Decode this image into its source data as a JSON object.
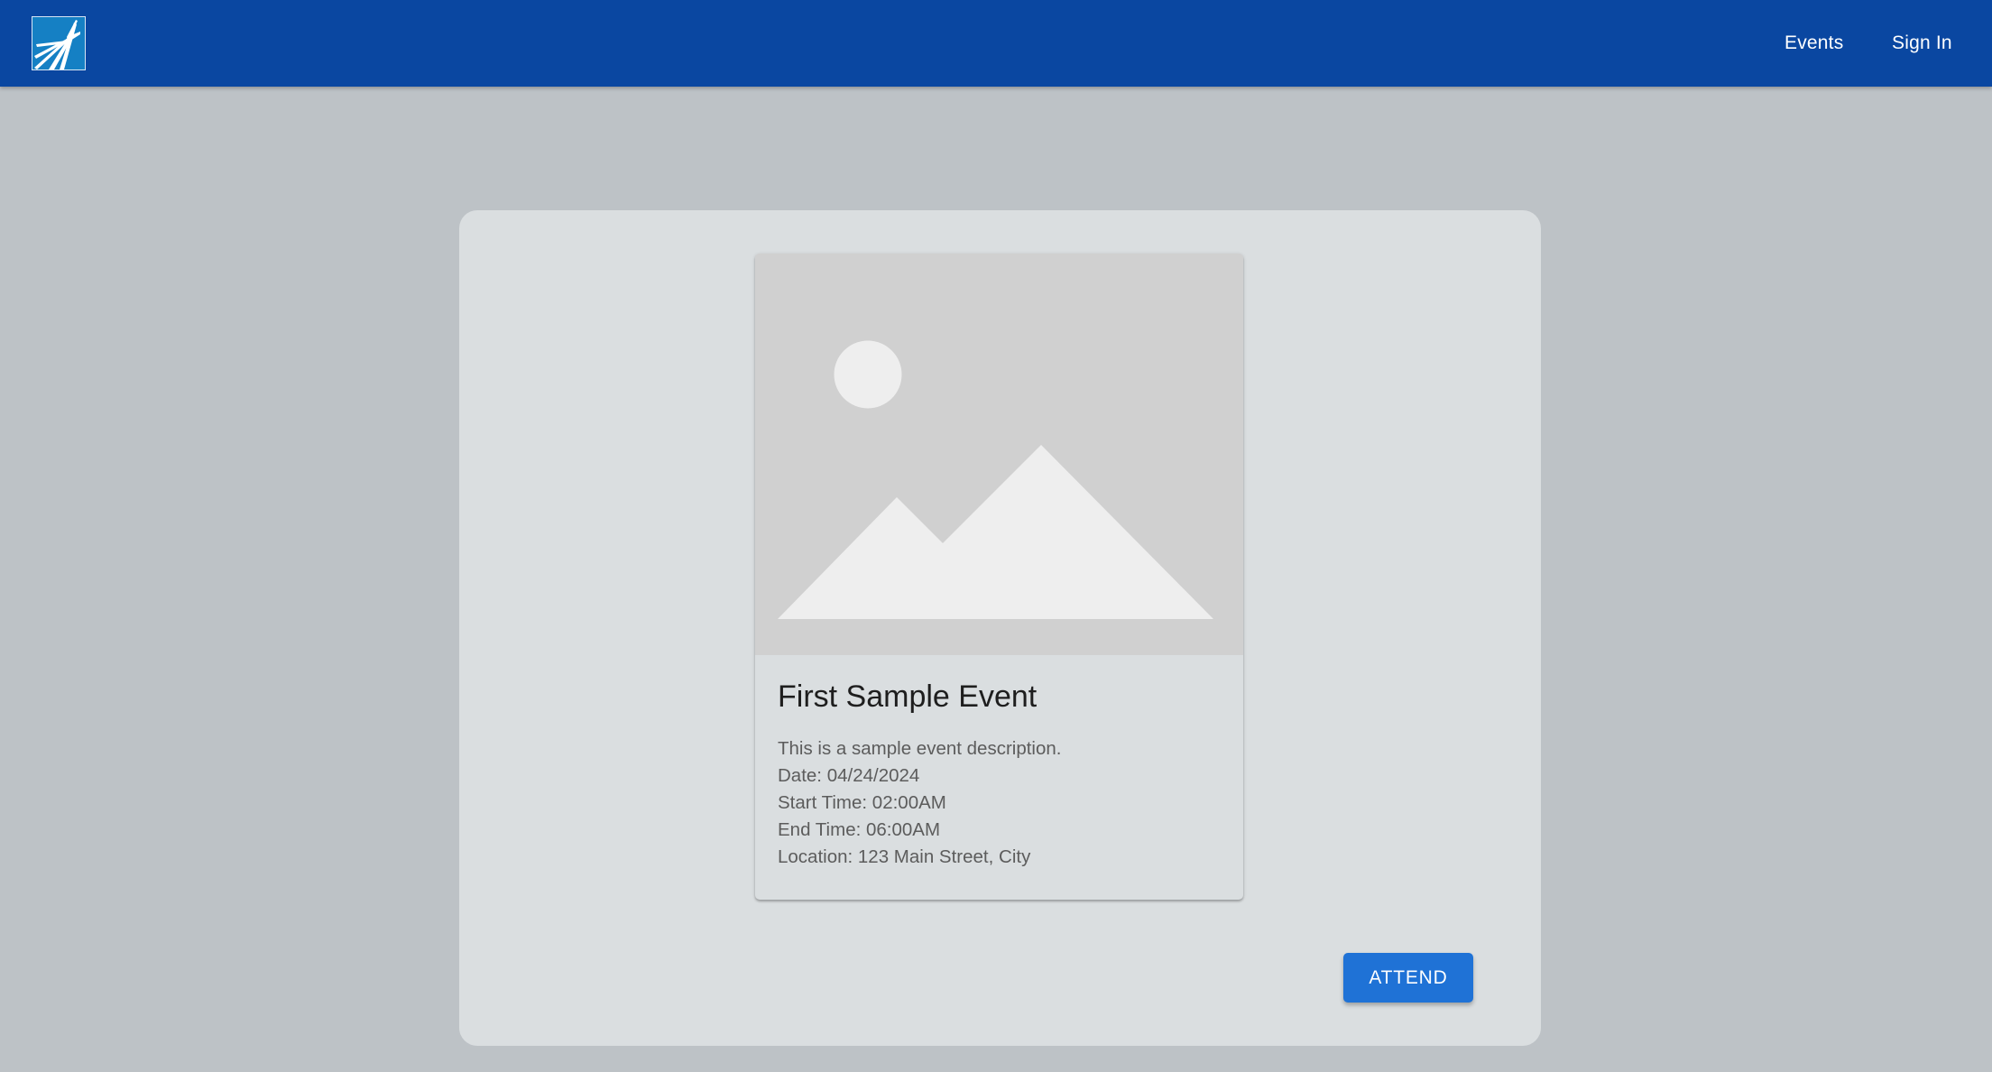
{
  "header": {
    "logo": "jet-plane-logo",
    "nav": {
      "events_label": "Events",
      "signin_label": "Sign In"
    }
  },
  "event_card": {
    "image": "image-placeholder-icon",
    "title": "First Sample Event",
    "description": "This is a sample event description.",
    "date_line": "Date: 04/24/2024",
    "start_line": "Start Time: 02:00AM",
    "end_line": "End Time: 06:00AM",
    "location_line": "Location: 123 Main Street, City"
  },
  "actions": {
    "attend_label": "ATTEND"
  },
  "colors": {
    "appbar": "#0a47a1",
    "page_background": "#bdc2c6",
    "panel_background": "#dadee0",
    "primary_button": "#1f72d6"
  }
}
